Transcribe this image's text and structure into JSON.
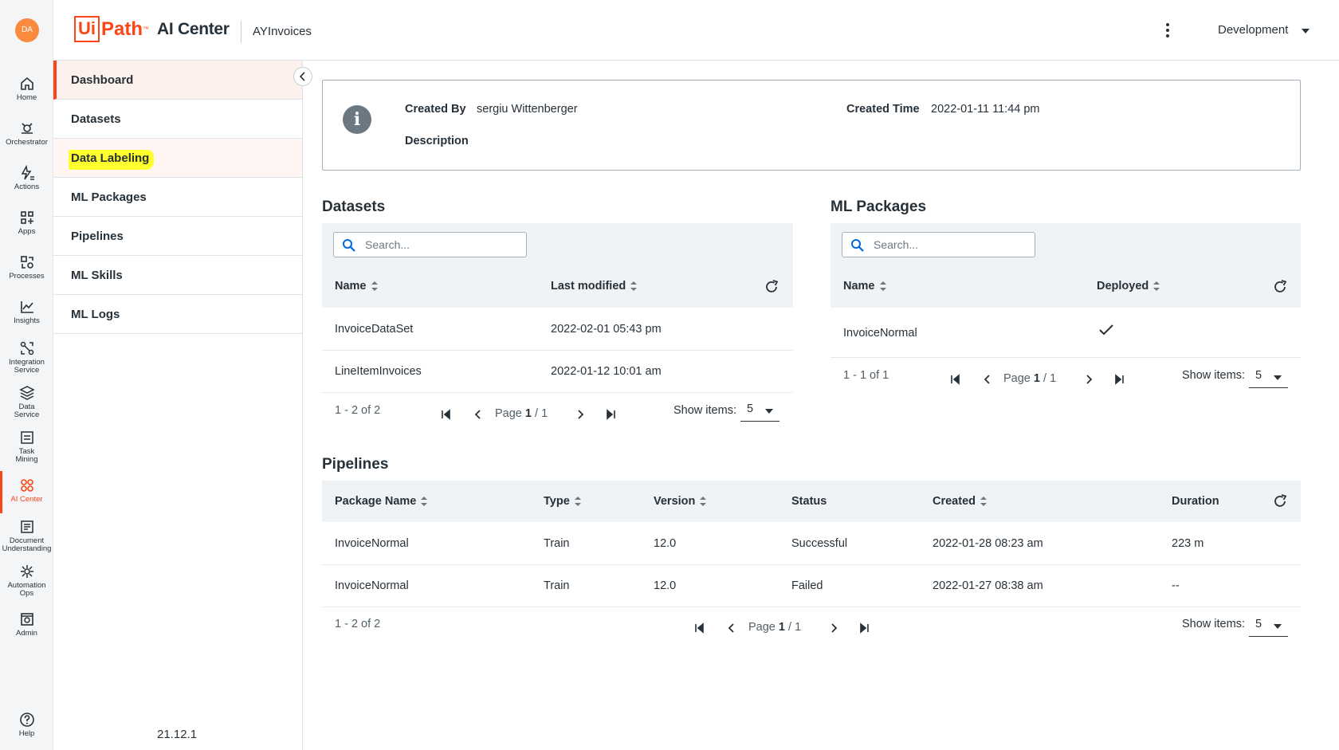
{
  "user": {
    "initials": "DA"
  },
  "rail": [
    {
      "label": "Home",
      "icon": "home-icon"
    },
    {
      "label": "Orchestrator",
      "icon": "orchestrator-icon"
    },
    {
      "label": "Actions",
      "icon": "actions-icon"
    },
    {
      "label": "Apps",
      "icon": "apps-icon"
    },
    {
      "label": "Processes",
      "icon": "processes-icon"
    },
    {
      "label": "Insights",
      "icon": "insights-icon"
    },
    {
      "label": "Integration Service",
      "icon": "integration-icon"
    },
    {
      "label": "Data Service",
      "icon": "data-service-icon"
    },
    {
      "label": "Task Mining",
      "icon": "task-mining-icon"
    },
    {
      "label": "AI Center",
      "icon": "ai-center-icon",
      "active": true
    },
    {
      "label": "Document Understanding",
      "icon": "document-understanding-icon"
    },
    {
      "label": "Automation Ops",
      "icon": "automation-ops-icon"
    },
    {
      "label": "Admin",
      "icon": "admin-icon"
    },
    {
      "label": "Help",
      "icon": "help-icon"
    }
  ],
  "header": {
    "logo_ui": "Ui",
    "logo_path": "Path",
    "logo_tm": "™",
    "product": "AI Center",
    "project": "AYInvoices",
    "environment": "Development"
  },
  "sidenav": {
    "items": [
      "Dashboard",
      "Datasets",
      "Data Labeling",
      "ML Packages",
      "Pipelines",
      "ML Skills",
      "ML Logs"
    ],
    "version": "21.12.1"
  },
  "info": {
    "created_by_label": "Created By",
    "created_by": "sergiu Wittenberger",
    "created_time_label": "Created Time",
    "created_time": "2022-01-11 11:44 pm",
    "description_label": "Description"
  },
  "datasets": {
    "title": "Datasets",
    "search_placeholder": "Search...",
    "columns": [
      "Name",
      "Last modified"
    ],
    "rows": [
      [
        "InvoiceDataSet",
        "2022-02-01 05:43 pm"
      ],
      [
        "LineItemInvoices",
        "2022-01-12 10:01 am"
      ]
    ],
    "range": "1 - 2 of 2",
    "page_label": "Page",
    "page": "1",
    "page_sep": "/",
    "pages": "1",
    "show_items_label": "Show items:",
    "show_items": "5"
  },
  "ml_packages": {
    "title": "ML Packages",
    "search_placeholder": "Search...",
    "columns": [
      "Name",
      "Deployed"
    ],
    "rows": [
      [
        "InvoiceNormal",
        "deployed-check"
      ]
    ],
    "range": "1 - 1 of 1",
    "page_label": "Page",
    "page": "1",
    "page_sep": "/",
    "pages": "1",
    "show_items_label": "Show items:",
    "show_items": "5"
  },
  "pipelines": {
    "title": "Pipelines",
    "columns": [
      "Package Name",
      "Type",
      "Version",
      "Status",
      "Created",
      "Duration"
    ],
    "rows": [
      [
        "InvoiceNormal",
        "Train",
        "12.0",
        "Successful",
        "2022-01-28 08:23 am",
        "223 m"
      ],
      [
        "InvoiceNormal",
        "Train",
        "12.0",
        "Failed",
        "2022-01-27 08:38 am",
        "--"
      ]
    ],
    "range": "1 - 2 of 2",
    "page_label": "Page",
    "page": "1",
    "page_sep": "/",
    "pages": "1",
    "show_items_label": "Show items:",
    "show_items": "5"
  },
  "colors": {
    "accent": "#fa4616",
    "highlight": "#ffff2e",
    "panel": "#f0f3f6",
    "avatar": "#fa8b3e"
  }
}
